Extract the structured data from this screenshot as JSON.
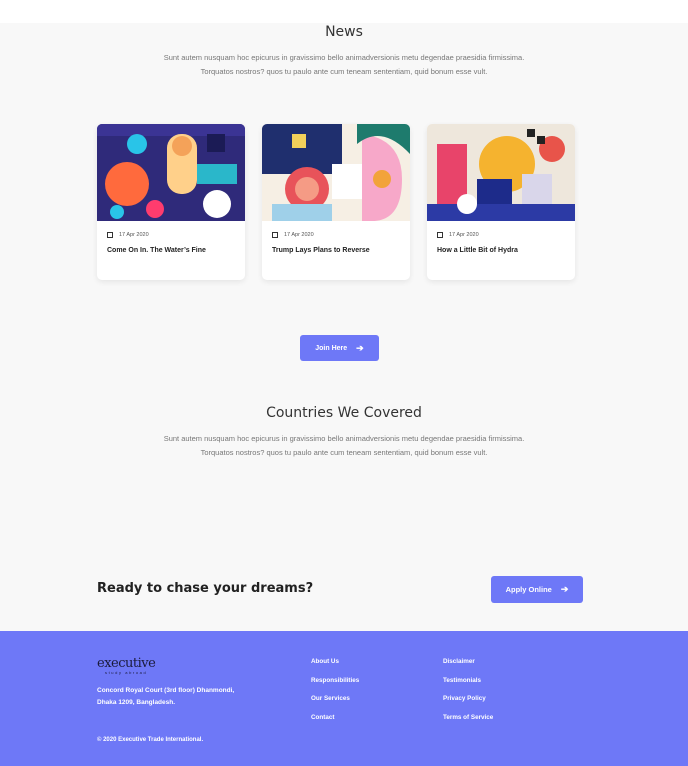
{
  "news": {
    "title": "News",
    "desc_line1": "Sunt autem nusquam hoc epicurus in gravissimo bello animadversionis metu degendae praesidia firmissima.",
    "desc_line2": "Torquatos nostros? quos tu paulo ante cum teneam sententiam, quid bonum esse vult.",
    "cards": [
      {
        "date": "17 Apr 2020",
        "title": "Come On In. The Water’s Fine"
      },
      {
        "date": "17 Apr 2020",
        "title": "Trump Lays Plans to Reverse"
      },
      {
        "date": "17 Apr 2020",
        "title": "How a Little Bit of Hydra"
      }
    ],
    "join_label": "Join Here"
  },
  "countries": {
    "title": "Countries We Covered",
    "desc_line1": "Sunt autem nusquam hoc epicurus in gravissimo bello animadversionis metu degendae praesidia firmissima.",
    "desc_line2": "Torquatos nostros? quos tu paulo ante cum teneam sententiam, quid bonum esse vult."
  },
  "cta": {
    "text": "Ready to chase your dreams?",
    "button_label": "Apply Online"
  },
  "footer": {
    "logo_main": "executive",
    "logo_sub": "study abroad",
    "address_line1": "Concord Royal Court (3rd floor) Dhanmondi,",
    "address_line2": "Dhaka 1209, Bangladesh.",
    "col1": [
      "About Us",
      "Responsibilities",
      "Our Services",
      "Contact"
    ],
    "col2": [
      "Disclaimer",
      "Testimonials",
      "Privacy Policy",
      "Terms of Service"
    ],
    "copyright": "© 2020 Executive Trade International."
  },
  "colors": {
    "accent": "#6e78f7",
    "background": "#f8f8f8"
  },
  "icons": {
    "calendar": "calendar-icon",
    "arrow": "arrow-right-icon"
  }
}
